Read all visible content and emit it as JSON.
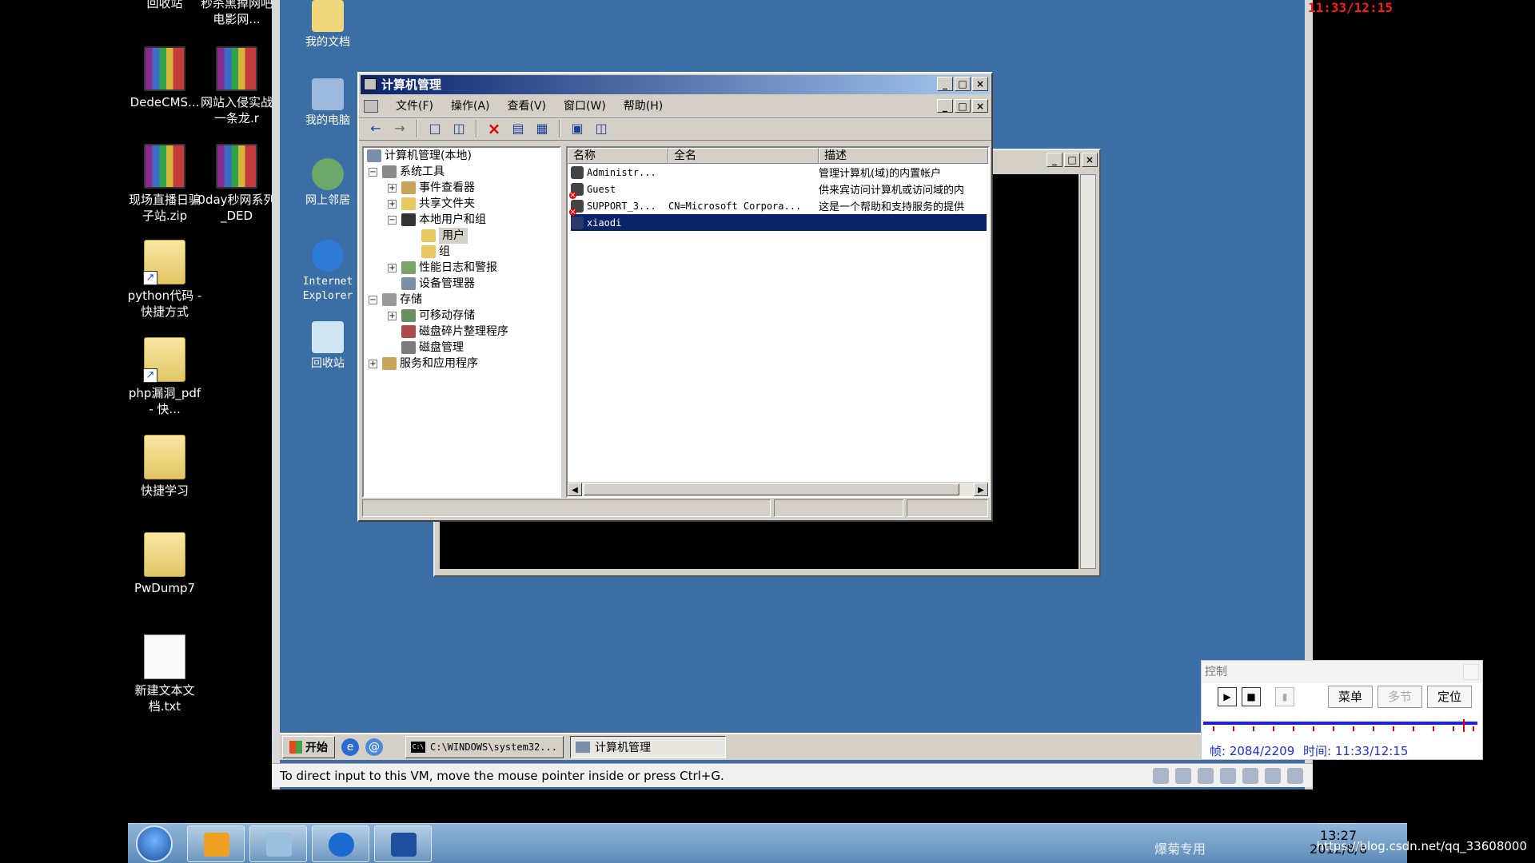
{
  "host_desktop": {
    "icons": [
      {
        "label": "回收站"
      },
      {
        "label": "秒杀黑掉网吧电影网..."
      },
      {
        "label": "DedeCMS..."
      },
      {
        "label": "网站入侵实战一条龙.r"
      },
      {
        "label": "现场直播日骗子站.zip"
      },
      {
        "label": "0day秒网系列_DED"
      },
      {
        "label": "python代码 - 快捷方式"
      },
      {
        "label": "php漏洞_pdf - 快..."
      },
      {
        "label": "快捷学习"
      },
      {
        "label": "PwDump7"
      },
      {
        "label": "新建文本文档.txt"
      }
    ]
  },
  "vm_clock": "11:33/12:15",
  "vm_desktop": {
    "icons": [
      {
        "label": "我的文档"
      },
      {
        "label": "我的电脑"
      },
      {
        "label": "网上邻居"
      },
      {
        "label": "Internet Explorer"
      },
      {
        "label": "回收站"
      }
    ]
  },
  "mmc": {
    "title": "计算机管理",
    "caption_buttons": {
      "minimize": "_",
      "maximize": "□",
      "close": "×"
    },
    "menu": [
      "文件(F)",
      "操作(A)",
      "查看(V)",
      "窗口(W)",
      "帮助(H)"
    ],
    "tree": [
      {
        "label": "计算机管理(本地)",
        "level": 0,
        "expander": ""
      },
      {
        "label": "系统工具",
        "level": 1,
        "expander": "−"
      },
      {
        "label": "事件查看器",
        "level": 2,
        "expander": "+"
      },
      {
        "label": "共享文件夹",
        "level": 2,
        "expander": "+"
      },
      {
        "label": "本地用户和组",
        "level": 2,
        "expander": "−"
      },
      {
        "label": "用户",
        "level": 3,
        "expander": "",
        "selected": true
      },
      {
        "label": "组",
        "level": 3,
        "expander": ""
      },
      {
        "label": "性能日志和警报",
        "level": 2,
        "expander": "+"
      },
      {
        "label": "设备管理器",
        "level": 2,
        "expander": ""
      },
      {
        "label": "存储",
        "level": 1,
        "expander": "−"
      },
      {
        "label": "可移动存储",
        "level": 2,
        "expander": "+"
      },
      {
        "label": "磁盘碎片整理程序",
        "level": 2,
        "expander": ""
      },
      {
        "label": "磁盘管理",
        "level": 2,
        "expander": ""
      },
      {
        "label": "服务和应用程序",
        "level": 1,
        "expander": "+"
      }
    ],
    "columns": [
      "名称",
      "全名",
      "描述"
    ],
    "rows": [
      {
        "name": "Administr...",
        "fullname": "",
        "desc": "管理计算机(域)的内置帐户",
        "disabled": false
      },
      {
        "name": "Guest",
        "fullname": "",
        "desc": "供来宾访问计算机或访问域的内",
        "disabled": true
      },
      {
        "name": "SUPPORT_3...",
        "fullname": "CN=Microsoft Corpora...",
        "desc": "这是一个帮助和支持服务的提供",
        "disabled": true
      },
      {
        "name": "xiaodi",
        "fullname": "",
        "desc": "",
        "selected": true
      }
    ]
  },
  "xp_taskbar": {
    "start_label": "开始",
    "tasks": [
      "C:\\WINDOWS\\system32...",
      "计算机管理"
    ]
  },
  "vm_status_text": "To direct input to this VM, move the mouse pointer inside or press Ctrl+G.",
  "control": {
    "title": "控制",
    "menu_label": "菜单",
    "multi_label": "多节",
    "locate_label": "定位",
    "frame_label": "帧:",
    "frame_value": "2084/2209",
    "time_label": "时间:",
    "time_value": "11:33/12:15",
    "progress": 0.943
  },
  "win7_taskbar": {
    "lang": "爆菊专用",
    "time": "13:27",
    "date": "2012/8/6"
  },
  "watermark": "https://blog.csdn.net/qq_33608000"
}
